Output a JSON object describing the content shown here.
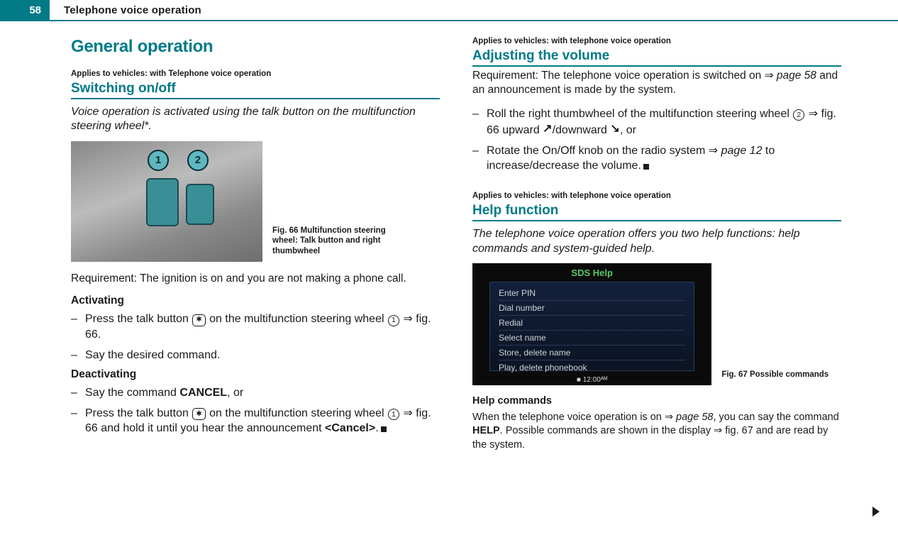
{
  "header": {
    "page_number": "58",
    "chapter_title": "Telephone voice operation"
  },
  "left": {
    "h1": "General operation",
    "applies": "Applies to vehicles: with Telephone voice operation",
    "h2_switch": "Switching on/off",
    "intro": "Voice operation is activated using the talk button on the multifunction steering wheel*.",
    "fig66_caption": "Fig. 66  Multifunction steering wheel: Talk button and right thumbwheel",
    "req": "Requirement: The ignition is on and you are not making a phone call.",
    "activating": "Activating",
    "act_b1_a": "Press the talk button ",
    "act_b1_b": " on the multifunction steering wheel ",
    "act_b1_c": " ⇒ fig. 66.",
    "act_b2": "Say the desired command.",
    "deactivating": "Deactivating",
    "deact_b1_a": "Say the command ",
    "deact_b1_b": "CANCEL",
    "deact_b1_c": ", or",
    "deact_b2_a": "Press the talk button ",
    "deact_b2_b": " on the multifunction steering wheel ",
    "deact_b2_c": " ⇒ fig. 66 and hold it until you hear the announcement ",
    "deact_b2_d": "<Cancel>",
    "deact_b2_e": "."
  },
  "right": {
    "vol_applies": "Applies to vehicles: with telephone voice operation",
    "vol_h2": "Adjusting the volume",
    "vol_req_a": "Requirement: The telephone voice operation is switched on ⇒ ",
    "vol_req_pageref": "page 58",
    "vol_req_b": " and an announcement is made by the system.",
    "vol_b1_a": "Roll the right thumbwheel of the multifunction steering wheel ",
    "vol_b1_b": " ⇒ fig. 66 upward ",
    "vol_b1_up": "↗",
    "vol_b1_c": "/downward ",
    "vol_b1_down": "↘",
    "vol_b1_d": ", or",
    "vol_b2_a": "Rotate the On/Off knob on the radio system ⇒ ",
    "vol_b2_pageref": "page 12",
    "vol_b2_b": " to increase/decrease the volume.",
    "help_applies": "Applies to vehicles: with telephone voice operation",
    "help_h2": "Help function",
    "help_intro": "The telephone voice operation offers you two help functions: help commands and system-guided help.",
    "sds_title": "SDS Help",
    "sds_items": [
      "Enter PIN",
      "Dial number",
      "Redial",
      "Select name",
      "Store, delete name",
      "Play, delete phonebook"
    ],
    "sds_clock": "■ 12:00ᴬᴹ",
    "fig67_caption": "Fig. 67  Possible commands",
    "help_cmds_h": "Help commands",
    "help_cmds_a": "When the telephone voice operation is on ⇒ ",
    "help_cmds_pageref": "page 58",
    "help_cmds_b": ", you can say the command ",
    "help_cmds_c": "HELP",
    "help_cmds_d": ". Possible commands are shown in the display ⇒ fig. 67 and are read by the system."
  }
}
